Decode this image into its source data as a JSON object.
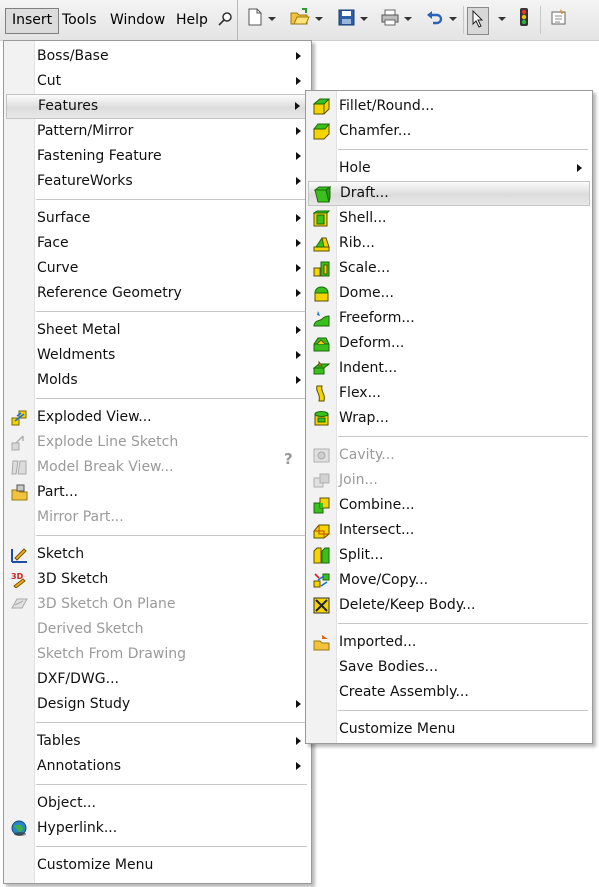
{
  "menubar": {
    "items": [
      "Insert",
      "Tools",
      "Window",
      "Help"
    ]
  },
  "icons": {
    "pin": "pushpin-icon",
    "new": "new-document-icon",
    "open": "open-folder-icon",
    "save": "save-disk-icon",
    "print": "print-icon",
    "undo": "undo-arrow-icon",
    "select": "select-cursor-icon",
    "rebuild": "traffic-light-icon",
    "options": "options-icon"
  },
  "insert_menu": {
    "items": [
      {
        "label": "Boss/Base",
        "submenu": true
      },
      {
        "label": "Cut",
        "submenu": true
      },
      {
        "label": "Features",
        "submenu": true,
        "highlighted": true
      },
      {
        "label": "Pattern/Mirror",
        "submenu": true
      },
      {
        "label": "Fastening Feature",
        "submenu": true
      },
      {
        "label": "FeatureWorks",
        "submenu": true
      },
      {
        "label": "Surface",
        "submenu": true
      },
      {
        "label": "Face",
        "submenu": true
      },
      {
        "label": "Curve",
        "submenu": true
      },
      {
        "label": "Reference Geometry",
        "submenu": true
      },
      {
        "label": "Sheet Metal",
        "submenu": true
      },
      {
        "label": "Weldments",
        "submenu": true
      },
      {
        "label": "Molds",
        "submenu": true
      },
      {
        "label": "Exploded View...",
        "icon": "exploded-view-icon"
      },
      {
        "label": "Explode Line Sketch",
        "icon": "explode-line-sketch-icon",
        "disabled": true
      },
      {
        "label": "Model Break View...",
        "icon": "model-break-view-icon",
        "disabled": true
      },
      {
        "label": "Part...",
        "icon": "part-icon"
      },
      {
        "label": "Mirror Part...",
        "disabled": true
      },
      {
        "label": "Sketch",
        "icon": "sketch-icon"
      },
      {
        "label": "3D Sketch",
        "icon": "3d-sketch-icon"
      },
      {
        "label": "3D Sketch On Plane",
        "icon": "3d-sketch-on-plane-icon",
        "disabled": true
      },
      {
        "label": "Derived Sketch",
        "disabled": true
      },
      {
        "label": "Sketch From Drawing",
        "disabled": true
      },
      {
        "label": "DXF/DWG..."
      },
      {
        "label": "Design Study",
        "submenu": true
      },
      {
        "label": "Tables",
        "submenu": true
      },
      {
        "label": "Annotations",
        "submenu": true
      },
      {
        "label": "Object..."
      },
      {
        "label": "Hyperlink...",
        "icon": "hyperlink-globe-icon"
      },
      {
        "label": "Customize Menu"
      }
    ],
    "help_glyph": "?"
  },
  "features_menu": {
    "items": [
      {
        "label": "Fillet/Round...",
        "icon": "fillet-icon"
      },
      {
        "label": "Chamfer...",
        "icon": "chamfer-icon"
      },
      {
        "label": "Hole",
        "submenu": true
      },
      {
        "label": "Draft...",
        "icon": "draft-icon",
        "highlighted": true
      },
      {
        "label": "Shell...",
        "icon": "shell-icon"
      },
      {
        "label": "Rib...",
        "icon": "rib-icon"
      },
      {
        "label": "Scale...",
        "icon": "scale-icon"
      },
      {
        "label": "Dome...",
        "icon": "dome-icon"
      },
      {
        "label": "Freeform...",
        "icon": "freeform-icon"
      },
      {
        "label": "Deform...",
        "icon": "deform-icon"
      },
      {
        "label": "Indent...",
        "icon": "indent-icon"
      },
      {
        "label": "Flex...",
        "icon": "flex-icon"
      },
      {
        "label": "Wrap...",
        "icon": "wrap-icon"
      },
      {
        "label": "Cavity...",
        "icon": "cavity-icon",
        "disabled": true
      },
      {
        "label": "Join...",
        "icon": "join-icon",
        "disabled": true
      },
      {
        "label": "Combine...",
        "icon": "combine-icon"
      },
      {
        "label": "Intersect...",
        "icon": "intersect-icon"
      },
      {
        "label": "Split...",
        "icon": "split-icon"
      },
      {
        "label": "Move/Copy...",
        "icon": "move-copy-icon"
      },
      {
        "label": "Delete/Keep Body...",
        "icon": "delete-keep-body-icon"
      },
      {
        "label": "Imported...",
        "icon": "imported-icon"
      },
      {
        "label": "Save Bodies..."
      },
      {
        "label": "Create Assembly..."
      },
      {
        "label": "Customize Menu"
      }
    ]
  },
  "colors": {
    "highlight": "#dcdcdc",
    "disabled_text": "#9a9a9a",
    "feature_green": "#3bbf1c",
    "feature_yellow": "#f5d400"
  }
}
